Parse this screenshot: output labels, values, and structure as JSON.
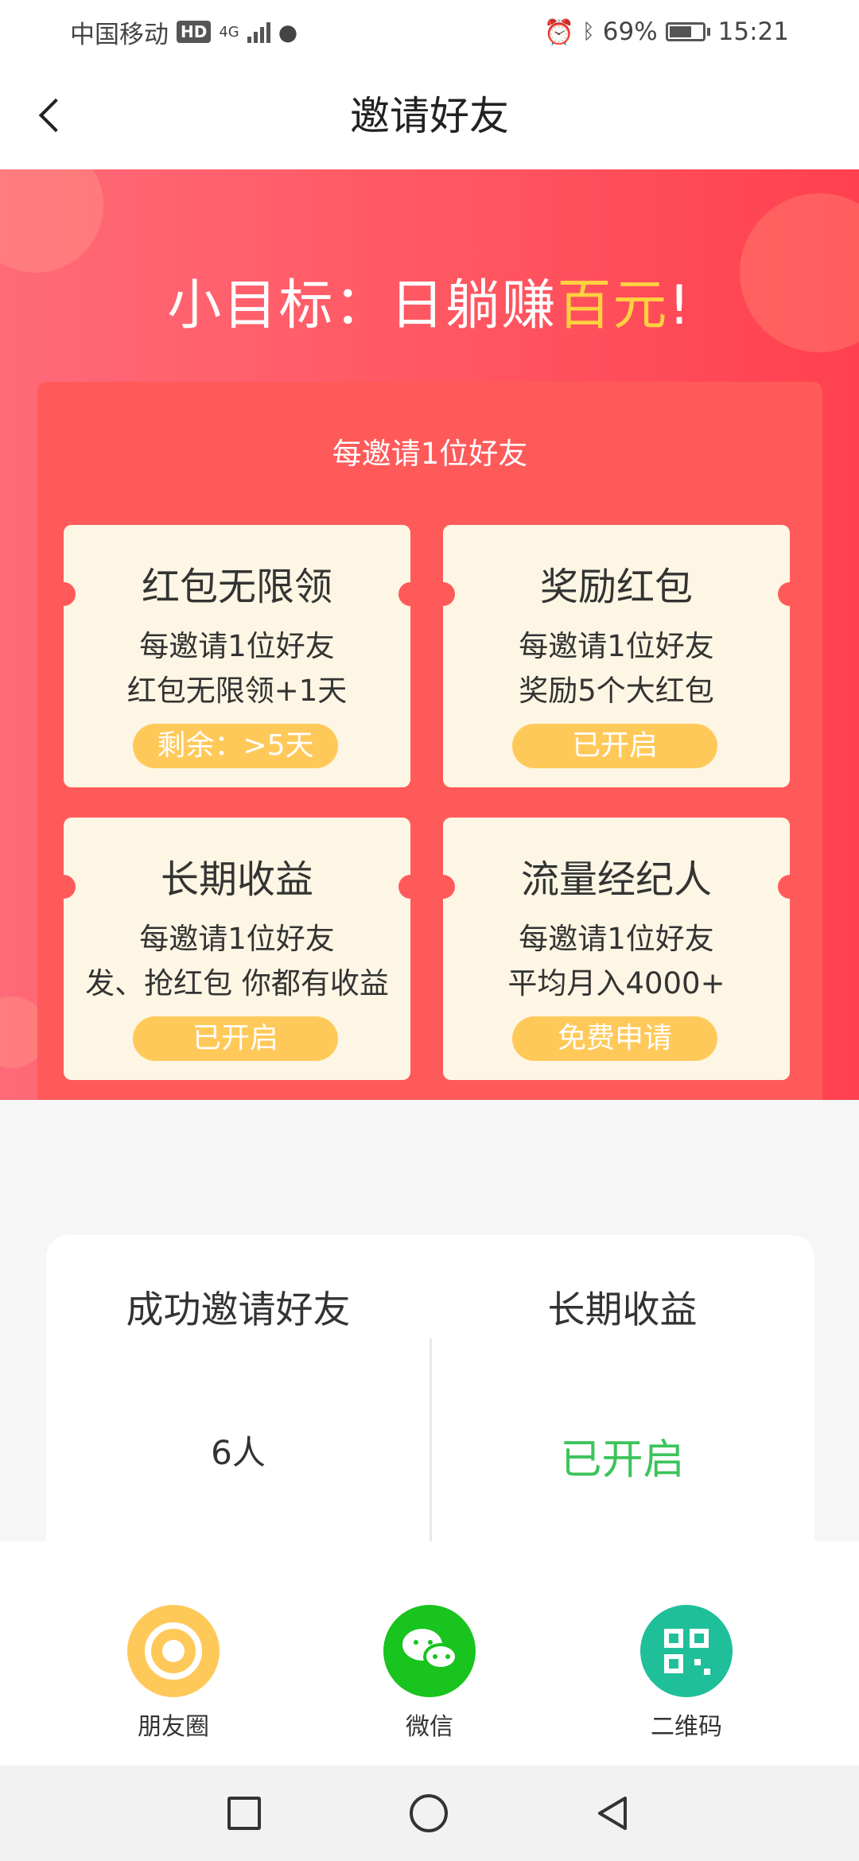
{
  "status_bar": {
    "carrier": "中国移动",
    "hd": "HD",
    "network": "4G",
    "battery_percent": "69%",
    "time": "15:21"
  },
  "nav": {
    "title": "邀请好友"
  },
  "hero": {
    "title_prefix": "小目标：日躺赚",
    "title_highlight": "百元",
    "title_suffix": "!",
    "subtitle": "每邀请1位好友"
  },
  "cards": [
    {
      "title": "红包无限领",
      "line1": "每邀请1位好友",
      "line2": "红包无限领+1天",
      "button": "剩余：>5天"
    },
    {
      "title": "奖励红包",
      "line1": "每邀请1位好友",
      "line2": "奖励5个大红包",
      "button": "已开启"
    },
    {
      "title": "长期收益",
      "line1": "每邀请1位好友",
      "line2": "发、抢红包 你都有收益",
      "button": "已开启"
    },
    {
      "title": "流量经纪人",
      "line1": "每邀请1位好友",
      "line2": "平均月入4000+",
      "button": "免费申请"
    }
  ],
  "stats": {
    "invited_label": "成功邀请好友",
    "invited_value": "6人",
    "income_label": "长期收益",
    "income_value": "已开启",
    "income_color": "#3cc45a"
  },
  "share": [
    {
      "label": "朋友圈",
      "icon": "moments-icon",
      "color": "#ffc95a"
    },
    {
      "label": "微信",
      "icon": "wechat-icon",
      "color": "#18c41d"
    },
    {
      "label": "二维码",
      "icon": "qrcode-icon",
      "color": "#1fbf9a"
    }
  ],
  "colors": {
    "hero_start": "#ff6a78",
    "hero_end": "#ff404f",
    "highlight": "#ffd040",
    "card_bg": "#fdf6e4",
    "pill": "#ffc95a"
  }
}
